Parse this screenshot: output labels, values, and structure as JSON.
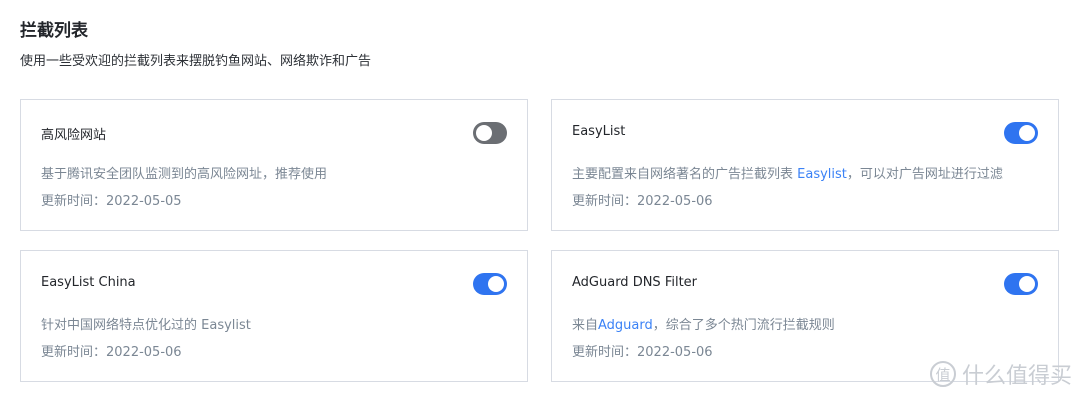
{
  "header": {
    "title": "拦截列表",
    "subtitle": "使用一些受欢迎的拦截列表来摆脱钓鱼网站、网络欺诈和广告"
  },
  "cards": [
    {
      "name": "高风险网站",
      "desc_parts": [
        "基于腾讯安全团队监测到的高风险网址，推荐使用"
      ],
      "updated": "更新时间：2022-05-05",
      "enabled": false
    },
    {
      "name": "EasyList",
      "desc_parts": [
        "主要配置来自网络著名的广告拦截列表 ",
        "Easylist",
        "，可以对广告网址进行过滤"
      ],
      "updated": "更新时间：2022-05-06",
      "enabled": true
    },
    {
      "name": "EasyList China",
      "desc_parts": [
        "针对中国网络特点优化过的 Easylist"
      ],
      "updated": "更新时间：2022-05-06",
      "enabled": true
    },
    {
      "name": "AdGuard DNS Filter",
      "desc_parts": [
        "来自",
        "Adguard",
        "，综合了多个热门流行拦截规则"
      ],
      "updated": "更新时间：2022-05-06",
      "enabled": true
    }
  ],
  "watermark": {
    "glyph": "值",
    "text": "什么值得买"
  },
  "colors": {
    "accent": "#2f74f0",
    "link": "#3b82f6",
    "toggle_off": "#6b6e73",
    "muted_text": "#7b8794"
  }
}
